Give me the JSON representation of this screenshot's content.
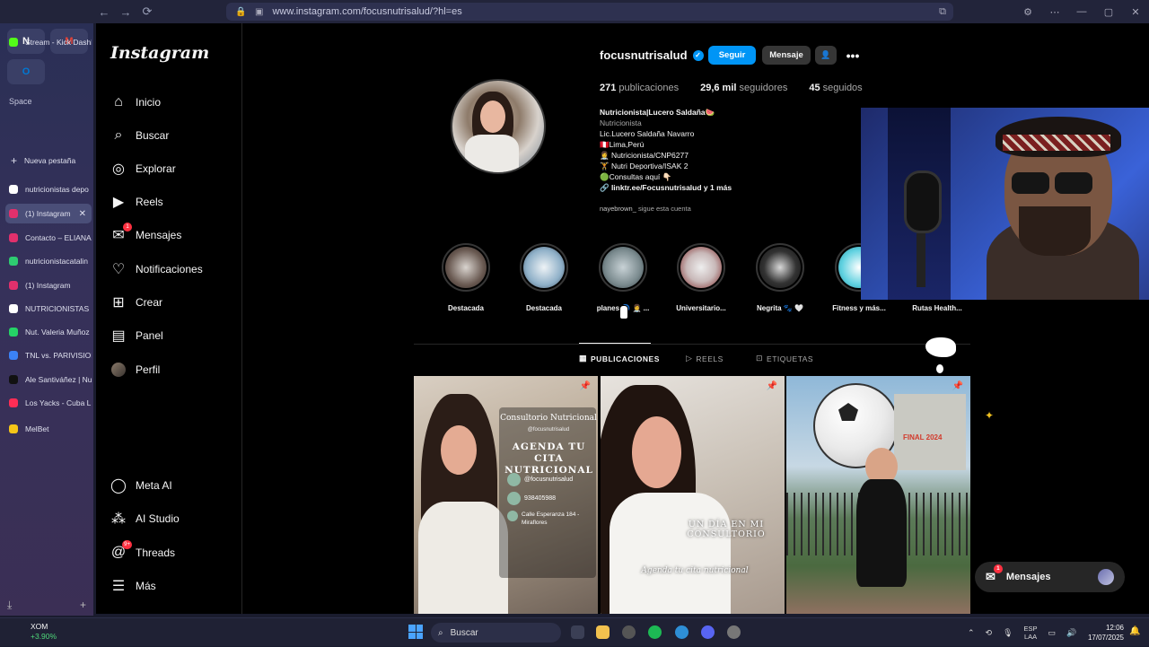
{
  "browser": {
    "url": "www.instagram.com/focusnutrisalud/?hl=es",
    "space_label": "Space",
    "new_tab": "Nueva pestaña",
    "pinned": [
      "N",
      "M",
      "O"
    ],
    "tabs": [
      {
        "label": "Stream - Kick Dashb",
        "color": "#53fc18"
      },
      {
        "label": "nutricionistas depo",
        "color": "#ffffff"
      },
      {
        "label": "(1) Instagram",
        "color": "#e1306c",
        "active": true
      },
      {
        "label": "Contacto – ELIANA",
        "color": "#e1306c"
      },
      {
        "label": "nutricionistacatalin",
        "color": "#2ecc71"
      },
      {
        "label": "(1) Instagram",
        "color": "#e1306c"
      },
      {
        "label": "NUTRICIONISTAS L",
        "color": "#ffffff"
      },
      {
        "label": "Nut. Valeria Muñoz",
        "color": "#25d366"
      },
      {
        "label": "TNL vs. PARIVISION",
        "color": "#3b82f6"
      },
      {
        "label": "Ale Santiváñez | Nu",
        "color": "#111111"
      },
      {
        "label": "Los Yacks - Cuba LL",
        "color": "#ff2d55"
      },
      {
        "label": "MelBet",
        "color": "#f5c518"
      }
    ]
  },
  "ig": {
    "logo": "Instagram",
    "nav": [
      {
        "label": "Inicio",
        "icon": "home-icon"
      },
      {
        "label": "Buscar",
        "icon": "search-icon"
      },
      {
        "label": "Explorar",
        "icon": "explore-icon"
      },
      {
        "label": "Reels",
        "icon": "reels-icon"
      },
      {
        "label": "Mensajes",
        "icon": "messages-icon",
        "badge": "1"
      },
      {
        "label": "Notificaciones",
        "icon": "heart-icon"
      },
      {
        "label": "Crear",
        "icon": "create-icon"
      },
      {
        "label": "Panel",
        "icon": "dashboard-icon"
      },
      {
        "label": "Perfil",
        "icon": "avatar"
      }
    ],
    "nav_bottom": [
      {
        "label": "Meta AI",
        "icon": "meta-ai-icon"
      },
      {
        "label": "AI Studio",
        "icon": "ai-studio-icon"
      },
      {
        "label": "Threads",
        "icon": "threads-icon",
        "badge": "9+"
      },
      {
        "label": "Más",
        "icon": "menu-icon"
      }
    ],
    "profile": {
      "username": "focusnutrisalud",
      "follow": "Seguir",
      "message": "Mensaje",
      "posts_count": "271",
      "posts_label": "publicaciones",
      "followers_count": "29,6 mil",
      "followers_label": "seguidores",
      "following_count": "45",
      "following_label": "seguidos",
      "bio_name": "Nutricionista|Lucero Saldaña🍉",
      "bio_category": "Nutricionista",
      "bio_lines": [
        "Lic.Lucero Saldaña Navarro",
        "🇵🇪Lima,Perú",
        "👩‍⚕️ Nutricionista/CNP6277",
        "🏋️ Nutri Deportiva/ISAK 2",
        "🟢Consultas aquí 👇🏻"
      ],
      "bio_link": "🔗 linktr.ee/Focusnutrisalud y 1 más",
      "followed_by_user": "nayebrown_",
      "followed_by_text": " sigue esta cuenta"
    },
    "highlights": [
      "Destacada",
      "Destacada",
      "planes 🔵 👩‍⚕️ ...",
      "Universitario...",
      "Negrita 🐾 🤍",
      "Fitness y más...",
      "Rutas Health..."
    ],
    "tabs": [
      "PUBLICACIONES",
      "REELS",
      "ETIQUETAS"
    ],
    "posts": [
      {
        "title": "Consultorio Nutricional",
        "handle": "@focusnutrisalud",
        "headline": "AGENDA TU CITA NUTRICIONAL",
        "ig": "@focusnutrisalud",
        "phone": "938405988",
        "address": "Calle Esperanza 184 - Miraflores"
      },
      {
        "line1": "UN DÍA EN MI",
        "line2": "CONSULTORIO",
        "caption": "Agenda tu cita nutricional"
      },
      {
        "text": "FINAL 2024"
      }
    ],
    "messages_pill": {
      "label": "Mensajes",
      "badge": "1"
    }
  },
  "taskbar": {
    "ticker": "XOM",
    "ticker_change": "+3.90%",
    "search": "Buscar",
    "lang1": "ESP",
    "lang2": "LAA",
    "time": "12:06",
    "date": "17/07/2025"
  }
}
